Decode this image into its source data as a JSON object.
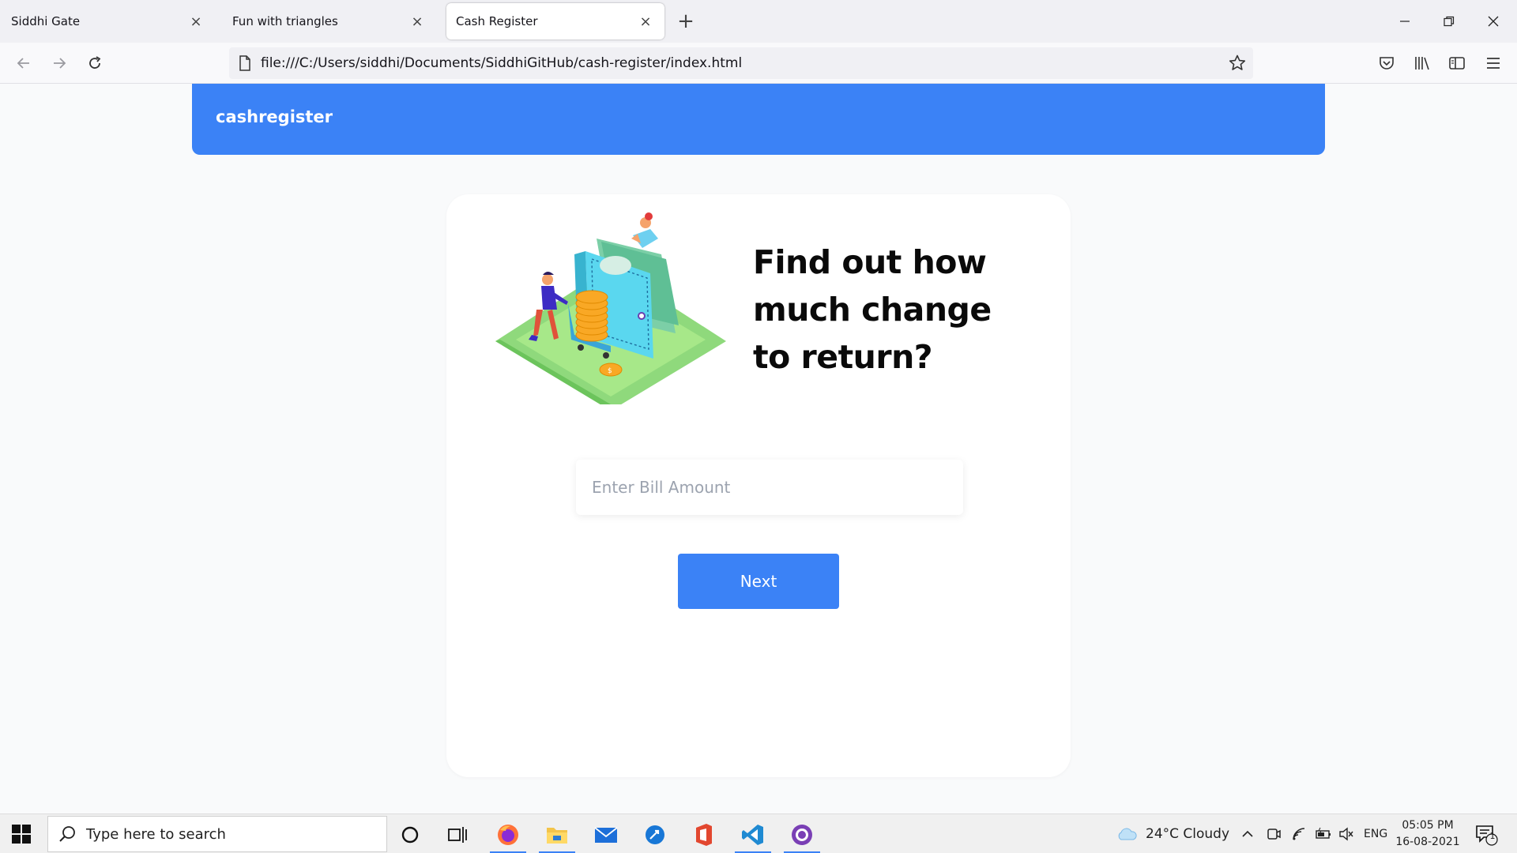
{
  "browser": {
    "tabs": [
      {
        "label": "Siddhi Gate",
        "active": false
      },
      {
        "label": "Fun with triangles",
        "active": false
      },
      {
        "label": "Cash Register",
        "active": true
      }
    ],
    "url": "file:///C:/Users/siddhi/Documents/SiddhiGitHub/cash-register/index.html"
  },
  "app": {
    "brand": "cashregister",
    "headline": "Find out how much change to return?",
    "bill_input": {
      "placeholder": "Enter Bill Amount",
      "value": ""
    },
    "next_label": "Next",
    "accent_color": "#3b82f6"
  },
  "taskbar": {
    "search_placeholder": "Type here to search",
    "weather": "24°C  Cloudy",
    "language": "ENG",
    "time": "05:05 PM",
    "date": "16-08-2021",
    "notification_count": "1",
    "pinned_apps": [
      "cortana-icon",
      "task-view-icon",
      "firefox-icon",
      "file-explorer-icon",
      "mail-icon",
      "edge-icon",
      "office-icon",
      "vscode-icon",
      "github-desktop-icon"
    ]
  }
}
